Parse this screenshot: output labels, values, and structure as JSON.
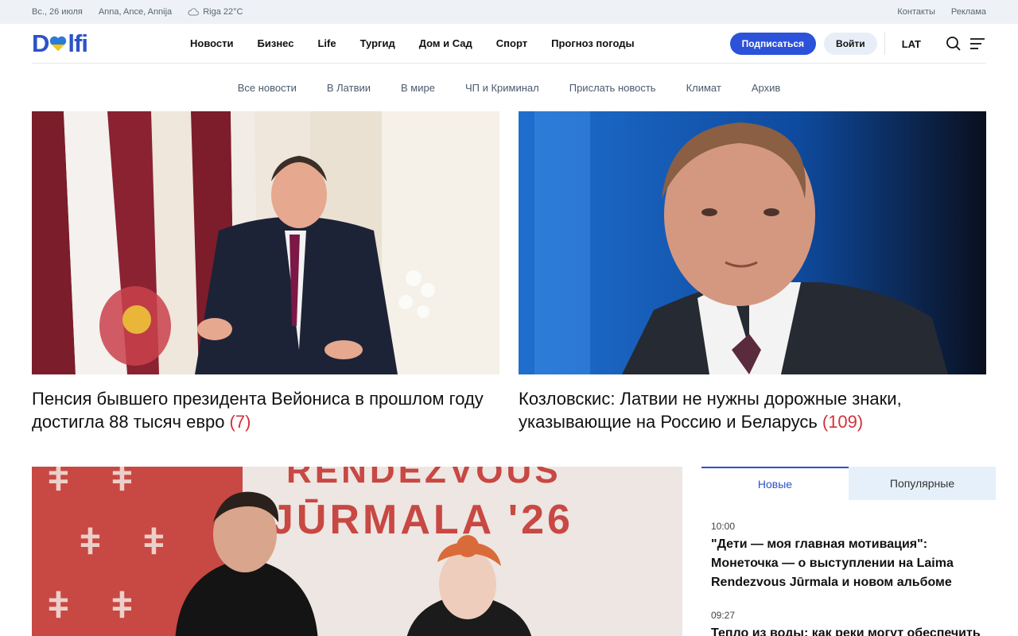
{
  "topbar": {
    "date": "Вс., 26 июля",
    "namedays": "Anna, Ance, Annija",
    "weather": "Riga 22°C",
    "links": [
      "Контакты",
      "Реклама"
    ]
  },
  "header": {
    "logo_left": "D",
    "logo_right": "lfi",
    "nav": [
      "Новости",
      "Бизнес",
      "Life",
      "Тургид",
      "Дом и Сад",
      "Спорт",
      "Прогноз погоды"
    ],
    "subscribe": "Подписаться",
    "login": "Войти",
    "lang": "LAT"
  },
  "subnav": [
    "Все новости",
    "В Латвии",
    "В мире",
    "ЧП и Криминал",
    "Прислать новость",
    "Климат",
    "Архив"
  ],
  "hero": [
    {
      "title": "Пенсия бывшего президента Вейониса в прошлом году достигла 88 тысяч евро",
      "comments": "(7)"
    },
    {
      "title": "Козловскис: Латвии не нужны дорожные знаки, указывающие на Россию и Беларусь",
      "comments": "(109)"
    }
  ],
  "lower_image_text": "RENDEZVOUS JŪRMALA '26",
  "sidebar": {
    "tabs": [
      "Новые",
      "Популярные"
    ],
    "feed": [
      {
        "time": "10:00",
        "title": "\"Дети — моя главная мотивация\": Монеточка — о выступлении на Laima Rendezvous Jūrmala и новом альбоме"
      },
      {
        "time": "09:27",
        "title": "Тепло из воды: как реки могут обеспечить"
      }
    ]
  },
  "colors": {
    "brand": "#2b52c8",
    "accent_red": "#d0333b",
    "topbar_bg": "#eef2f6"
  }
}
